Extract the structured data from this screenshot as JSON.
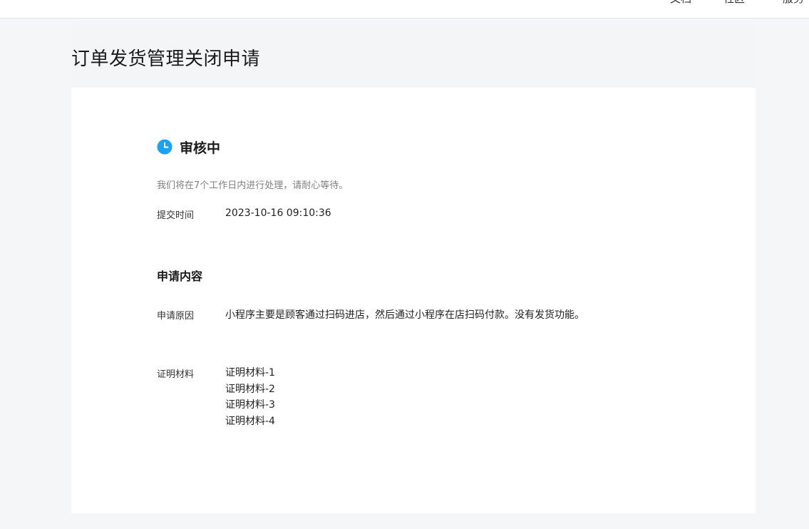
{
  "topbar": {
    "nav_items": [
      "文档",
      "社区",
      "服务"
    ]
  },
  "page": {
    "title": "订单发货管理关闭申请"
  },
  "status": {
    "icon": "clock-icon",
    "icon_color": "#1aa3f5",
    "label": "审核中",
    "description": "我们将在7个工作日内进行处理，请耐心等待。",
    "submit_time_label": "提交时间",
    "submit_time_value": "2023-10-16 09:10:36"
  },
  "application": {
    "section_title": "申请内容",
    "reason_label": "申请原因",
    "reason_value": "小程序主要是顾客通过扫码进店，然后通过小程序在店扫码付款。没有发货功能。",
    "materials_label": "证明材料",
    "materials": [
      "证明材料-1",
      "证明材料-2",
      "证明材料-3",
      "证明材料-4"
    ]
  }
}
